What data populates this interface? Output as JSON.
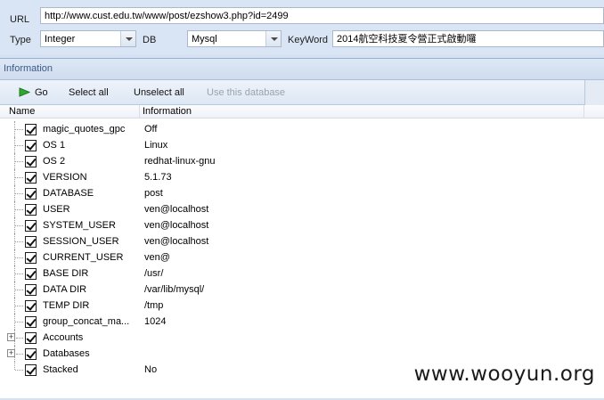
{
  "form": {
    "url_label": "URL",
    "url_value": "http://www.cust.edu.tw/www/post/ezshow3.php?id=2499",
    "type_label": "Type",
    "type_value": "Integer",
    "db_label": "DB",
    "db_value": "Mysql",
    "keyword_label": "KeyWord",
    "keyword_value": "2014航空科技夏令營正式啟動囉"
  },
  "panel": {
    "title": "Information"
  },
  "toolbar": {
    "go": "Go",
    "select_all": "Select all",
    "unselect_all": "Unselect all",
    "use_db": "Use this database"
  },
  "columns": {
    "name": "Name",
    "info": "Information"
  },
  "rows": [
    {
      "name": "magic_quotes_gpc",
      "info": "Off"
    },
    {
      "name": "OS 1",
      "info": "Linux"
    },
    {
      "name": "OS 2",
      "info": "redhat-linux-gnu"
    },
    {
      "name": "VERSION",
      "info": "5.1.73"
    },
    {
      "name": "DATABASE",
      "info": "post"
    },
    {
      "name": "USER",
      "info": "ven@localhost"
    },
    {
      "name": "SYSTEM_USER",
      "info": "ven@localhost"
    },
    {
      "name": "SESSION_USER",
      "info": "ven@localhost"
    },
    {
      "name": "CURRENT_USER",
      "info": "ven@"
    },
    {
      "name": "BASE DIR",
      "info": "/usr/"
    },
    {
      "name": "DATA DIR",
      "info": "/var/lib/mysql/"
    },
    {
      "name": "TEMP DIR",
      "info": "/tmp"
    },
    {
      "name": "group_concat_ma...",
      "info": "1024"
    },
    {
      "name": "Accounts",
      "info": ""
    },
    {
      "name": "Databases",
      "info": ""
    },
    {
      "name": "Stacked",
      "info": "No"
    }
  ],
  "watermark": "www.wooyun.org",
  "colors": {
    "accent": "#3b5a86",
    "go_icon": "#2fa82f"
  }
}
